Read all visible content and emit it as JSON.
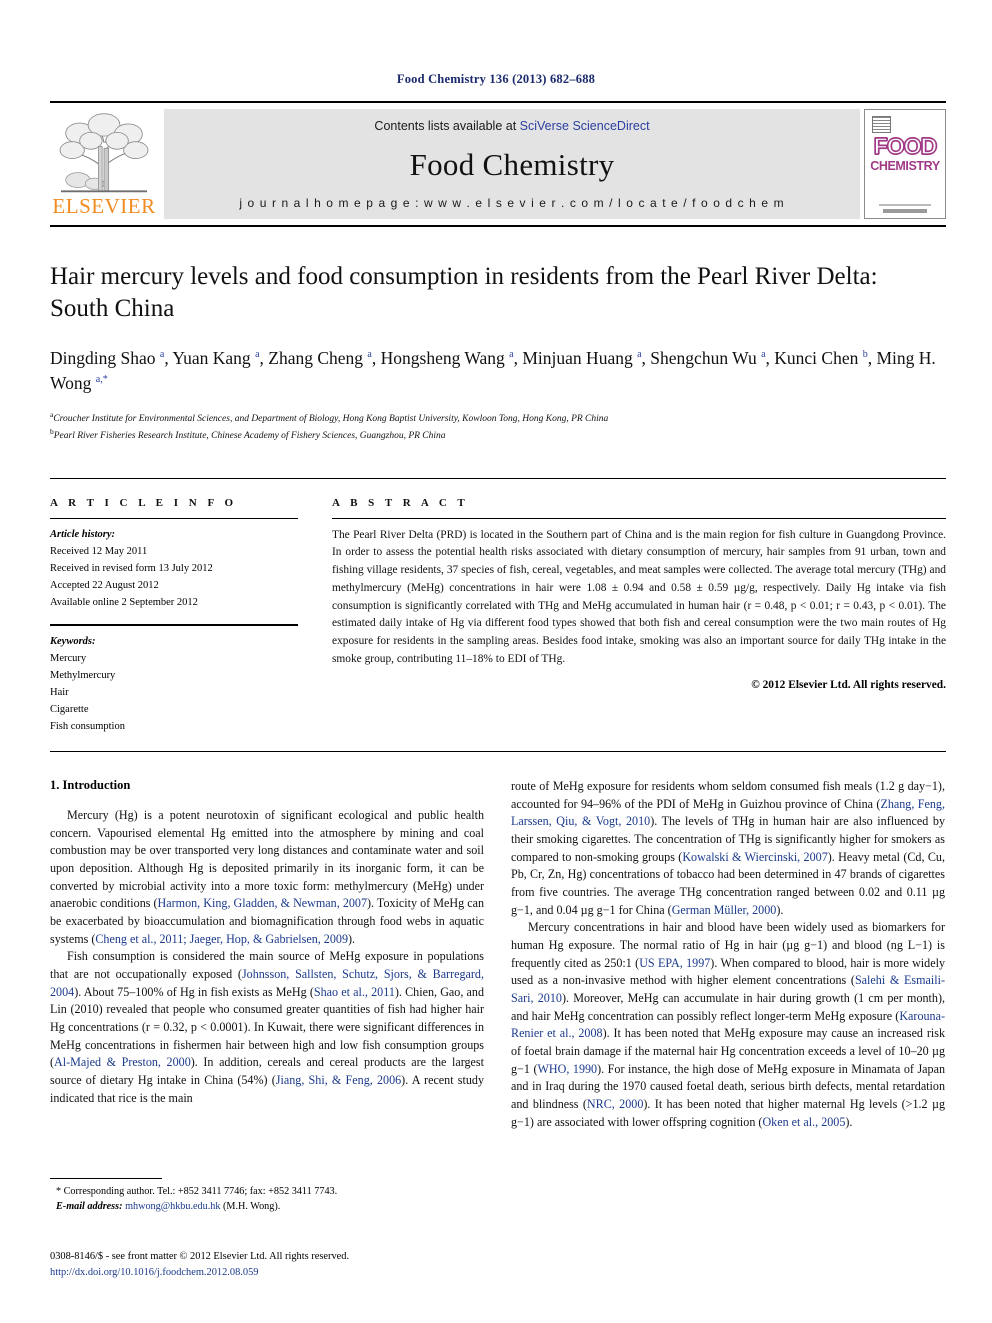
{
  "running_head": "Food Chemistry 136 (2013) 682–688",
  "masthead": {
    "contents_prefix": "Contents lists available at ",
    "sciencedirect_link": "SciVerse ScienceDirect",
    "journal_title": "Food Chemistry",
    "homepage": "j o u r n a l   h o m e p a g e :   w w w . e l s e v i e r . c o m / l o c a t e / f o o d c h e m",
    "publisher_name": "ELSEVIER",
    "cover_food": "FOOD",
    "cover_chemistry": "CHEMISTRY",
    "accent_orange": "#F08C21",
    "accent_link": "#2b3fa0",
    "cover_magenta": "#a03a86"
  },
  "article": {
    "title": "Hair mercury levels and food consumption in residents from the Pearl River Delta: South China",
    "authors_html": "Dingding Shao <sup>a</sup>, Yuan Kang <sup>a</sup>, Zhang Cheng <sup>a</sup>, Hongsheng Wang <sup>a</sup>, Minjuan Huang <sup>a</sup>, Shengchun Wu <sup>a</sup>, Kunci Chen <sup>b</sup>, Ming H. Wong <sup>a,*</sup>",
    "affiliation_a": "Croucher Institute for Environmental Sciences, and Department of Biology, Hong Kong Baptist University, Kowloon Tong, Hong Kong, PR China",
    "affiliation_b": "Pearl River Fisheries Research Institute, Chinese Academy of Fishery Sciences, Guangzhou, PR China"
  },
  "article_info": {
    "heading": "A R T I C L E   I N F O",
    "history_label": "Article history:",
    "history": [
      "Received 12 May 2011",
      "Received in revised form 13 July 2012",
      "Accepted 22 August 2012",
      "Available online 2 September 2012"
    ],
    "keywords_label": "Keywords:",
    "keywords": [
      "Mercury",
      "Methylmercury",
      "Hair",
      "Cigarette",
      "Fish consumption"
    ]
  },
  "abstract": {
    "heading": "A B S T R A C T",
    "text": "The Pearl River Delta (PRD) is located in the Southern part of China and is the main region for fish culture in Guangdong Province. In order to assess the potential health risks associated with dietary consumption of mercury, hair samples from 91 urban, town and fishing village residents, 37 species of fish, cereal, vegetables, and meat samples were collected. The average total mercury (THg) and methylmercury (MeHg) concentrations in hair were 1.08 ± 0.94 and 0.58 ± 0.59 µg/g, respectively. Daily Hg intake via fish consumption is significantly correlated with THg and MeHg accumulated in human hair (r = 0.48, p < 0.01; r = 0.43, p < 0.01). The estimated daily intake of Hg via different food types showed that both fish and cereal consumption were the two main routes of Hg exposure for residents in the sampling areas. Besides food intake, smoking was also an important source for daily THg intake in the smoke group, contributing 11–18% to EDI of THg.",
    "copyright": "© 2012 Elsevier Ltd. All rights reserved."
  },
  "introduction": {
    "heading": "1. Introduction",
    "left_paragraphs": [
      "Mercury (Hg) is a potent neurotoxin of significant ecological and public health concern. Vapourised elemental Hg emitted into the atmosphere by mining and coal combustion may be over transported very long distances and contaminate water and soil upon deposition. Although Hg is deposited primarily in its inorganic form, it can be converted by microbial activity into a more toxic form: methylmercury (MeHg) under anaerobic conditions (Harmon, King, Gladden, & Newman, 2007). Toxicity of MeHg can be exacerbated by bioaccumulation and biomagnification through food webs in aquatic systems (Cheng et al., 2011; Jaeger, Hop, & Gabrielsen, 2009).",
      "Fish consumption is considered the main source of MeHg exposure in populations that are not occupationally exposed (Johnsson, Sallsten, Schutz, Sjors, & Barregard, 2004). About 75–100% of Hg in fish exists as MeHg (Shao et al., 2011). Chien, Gao, and Lin (2010) revealed that people who consumed greater quantities of fish had higher hair Hg concentrations (r = 0.32, p < 0.0001). In Kuwait, there were significant differences in MeHg concentrations in fishermen hair between high and low fish consumption groups (Al-Majed & Preston, 2000). In addition, cereals and cereal products are the largest source of dietary Hg intake in China (54%) (Jiang, Shi, & Feng, 2006). A recent study indicated that rice is the main"
    ],
    "right_paragraphs": [
      "route of MeHg exposure for residents whom seldom consumed fish meals (1.2 g day−1), accounted for 94–96% of the PDI of MeHg in Guizhou province of China (Zhang, Feng, Larssen, Qiu, & Vogt, 2010). The levels of THg in human hair are also influenced by their smoking cigarettes. The concentration of THg is significantly higher for smokers as compared to non-smoking groups (Kowalski & Wiercinski, 2007). Heavy metal (Cd, Cu, Pb, Cr, Zn, Hg) concentrations of tobacco had been determined in 47 brands of cigarettes from five countries. The average THg concentration ranged between 0.02 and 0.11 µg g−1, and 0.04 µg g−1 for China (German Müller, 2000).",
      "Mercury concentrations in hair and blood have been widely used as biomarkers for human Hg exposure. The normal ratio of Hg in hair (µg g−1) and blood (ng L−1) is frequently cited as 250:1 (US EPA, 1997). When compared to blood, hair is more widely used as a non-invasive method with higher element concentrations (Salehi & Esmaili-Sari, 2010). Moreover, MeHg can accumulate in hair during growth (1 cm per month), and hair MeHg concentration can possibly reflect longer-term MeHg exposure (Karouna-Renier et al., 2008). It has been noted that MeHg exposure may cause an increased risk of foetal brain damage if the maternal hair Hg concentration exceeds a level of 10–20 µg g−1 (WHO, 1990). For instance, the high dose of MeHg exposure in Minamata of Japan and in Iraq during the 1970 caused foetal death, serious birth defects, mental retardation and blindness (NRC, 2000). It has been noted that higher maternal Hg levels (>1.2 µg g−1) are associated with lower offspring cognition (Oken et al., 2005)."
    ]
  },
  "footnote": {
    "corresponding": "* Corresponding author. Tel.: +852 3411 7746; fax: +852 3411 7743.",
    "email_label": "E-mail address:",
    "email": "mhwong@hkbu.edu.hk",
    "email_suffix": "(M.H. Wong)."
  },
  "imprint": {
    "issn_line": "0308-8146/$ - see front matter © 2012 Elsevier Ltd. All rights reserved.",
    "doi": "http://dx.doi.org/10.1016/j.foodchem.2012.08.059"
  }
}
